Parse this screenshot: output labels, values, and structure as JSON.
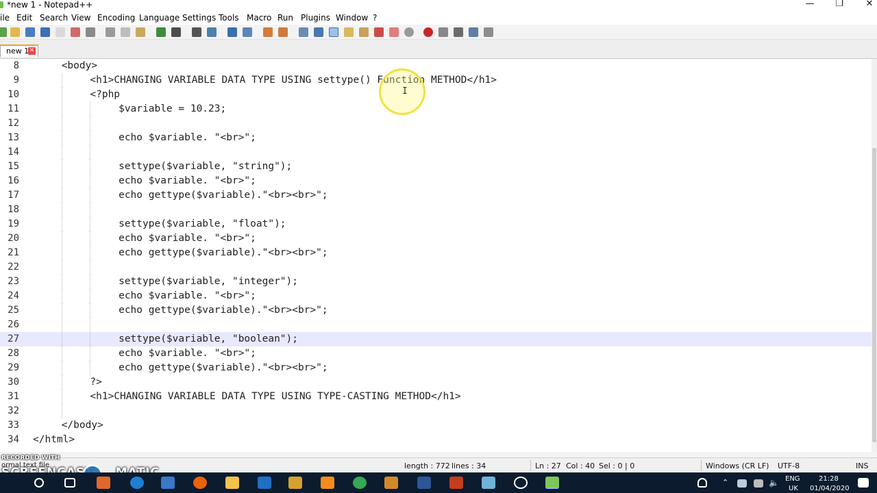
{
  "window": {
    "title": "*new 1 - Notepad++",
    "controls": {
      "minimize": "—",
      "restore": "❐",
      "close": "✕"
    }
  },
  "menu": [
    "ile",
    "Edit",
    "Search",
    "View",
    "Encoding",
    "Language",
    "Settings",
    "Tools",
    "Macro",
    "Run",
    "Plugins",
    "Window",
    "?"
  ],
  "tabs": [
    {
      "label": "new 1",
      "close": "✕"
    }
  ],
  "editor": {
    "current_line": 27,
    "lines": [
      {
        "n": "8",
        "text": "<body>",
        "indent": 1
      },
      {
        "n": "9",
        "text": "<h1>CHANGING VARIABLE DATA TYPE USING settype() Function METHOD</h1>",
        "indent": 2
      },
      {
        "n": "10",
        "text": "<?php",
        "indent": 2
      },
      {
        "n": "11",
        "text": "$variable = 10.23;",
        "indent": 3
      },
      {
        "n": "12",
        "text": "",
        "indent": 3
      },
      {
        "n": "13",
        "text": "echo $variable. \"<br>\";",
        "indent": 3
      },
      {
        "n": "14",
        "text": "",
        "indent": 3
      },
      {
        "n": "15",
        "text": "settype($variable, \"string\");",
        "indent": 3
      },
      {
        "n": "16",
        "text": "echo $variable. \"<br>\";",
        "indent": 3
      },
      {
        "n": "17",
        "text": "echo gettype($variable).\"<br><br>\";",
        "indent": 3
      },
      {
        "n": "18",
        "text": "",
        "indent": 3
      },
      {
        "n": "19",
        "text": "settype($variable, \"float\");",
        "indent": 3
      },
      {
        "n": "20",
        "text": "echo $variable. \"<br>\";",
        "indent": 3
      },
      {
        "n": "21",
        "text": "echo gettype($variable).\"<br><br>\";",
        "indent": 3
      },
      {
        "n": "22",
        "text": "",
        "indent": 3
      },
      {
        "n": "23",
        "text": "settype($variable, \"integer\");",
        "indent": 3
      },
      {
        "n": "24",
        "text": "echo $variable. \"<br>\";",
        "indent": 3
      },
      {
        "n": "25",
        "text": "echo gettype($variable).\"<br><br>\";",
        "indent": 3
      },
      {
        "n": "26",
        "text": "",
        "indent": 3
      },
      {
        "n": "27",
        "text": "settype($variable, \"boolean\");",
        "indent": 3
      },
      {
        "n": "28",
        "text": "echo $variable. \"<br>\";",
        "indent": 3
      },
      {
        "n": "29",
        "text": "echo gettype($variable).\"<br><br>\";",
        "indent": 3
      },
      {
        "n": "30",
        "text": "?>",
        "indent": 2
      },
      {
        "n": "31",
        "text": "<h1>CHANGING VARIABLE DATA TYPE USING TYPE-CASTING METHOD</h1>",
        "indent": 2
      },
      {
        "n": "32",
        "text": "",
        "indent": 2
      },
      {
        "n": "33",
        "text": "</body>",
        "indent": 1
      },
      {
        "n": "34",
        "text": "</html>",
        "indent": 0
      }
    ]
  },
  "status": {
    "mode": "ormal text file",
    "length": "length : 772",
    "lines": "lines : 34",
    "ln": "Ln : 27",
    "col": "Col : 40",
    "sel": "Sel : 0 | 0",
    "eol": "Windows (CR LF)",
    "encoding": "UTF-8",
    "ins": "INS"
  },
  "watermark": {
    "recorded": "RECORDED WITH",
    "brand": "SCREENCAST",
    "brand_suffix": "MATIC"
  },
  "taskbar": {
    "lang": "ENG",
    "region": "UK",
    "time": "21:28",
    "date": "01/04/2020"
  },
  "colors": {
    "current_line": "#e8e8ff",
    "tab_accent": "#f0a030",
    "taskbar": "#0c1b2e"
  }
}
